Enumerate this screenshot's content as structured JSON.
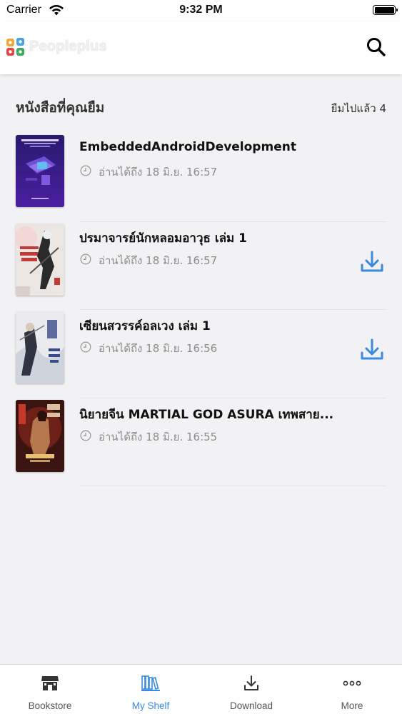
{
  "status_bar": {
    "carrier": "Carrier",
    "time": "9:32 PM"
  },
  "header": {
    "logo_text": "Peopleplus",
    "search_icon": "search-icon"
  },
  "shelf": {
    "title": "หนังสือที่คุณยืม",
    "borrow_count": "ยืมไปแล้ว 4",
    "books": [
      {
        "title": "EmbeddedAndroidDevelopment",
        "read_until": "อ่านได้ถึง 18 มิ.ย. 16:57",
        "downloadable": false
      },
      {
        "title": "ปรมาจารย์นักหลอมอาวุธ เล่ม 1",
        "read_until": "อ่านได้ถึง 18 มิ.ย. 16:57",
        "downloadable": true
      },
      {
        "title": "เซียนสวรรค์อลเวง เล่ม 1",
        "read_until": "อ่านได้ถึง 18 มิ.ย. 16:56",
        "downloadable": true
      },
      {
        "title": "นิยายจีน MARTIAL GOD ASURA เทพสาย...",
        "read_until": "อ่านได้ถึง 18 มิ.ย. 16:55",
        "downloadable": false
      }
    ]
  },
  "tabbar": {
    "items": [
      {
        "label": "Bookstore",
        "icon": "store-icon",
        "active": false
      },
      {
        "label": "My Shelf",
        "icon": "bookshelf-icon",
        "active": true
      },
      {
        "label": "Download",
        "icon": "download-icon",
        "active": false
      },
      {
        "label": "More",
        "icon": "more-icon",
        "active": false
      }
    ]
  },
  "colors": {
    "accent": "#3a8be0",
    "background": "#f2f2f4",
    "muted_text": "#8c8c8c"
  }
}
